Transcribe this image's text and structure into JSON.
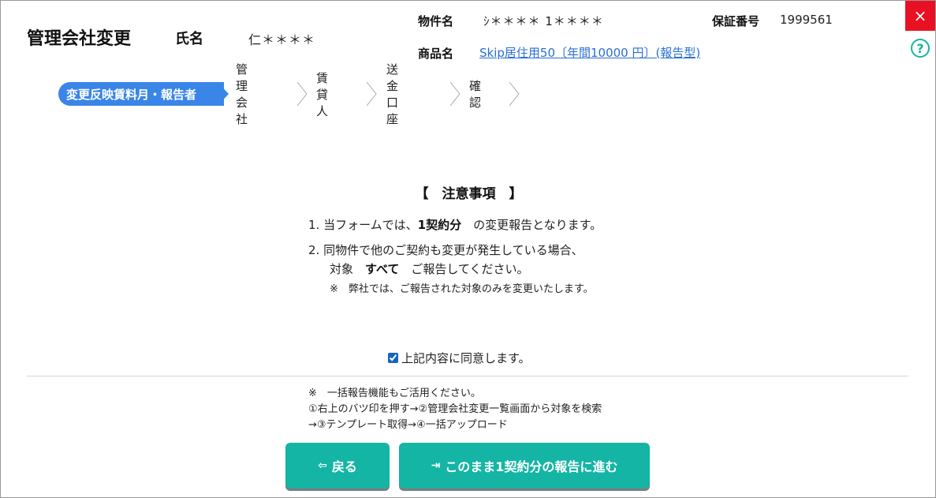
{
  "window": {
    "close_icon": "×",
    "help_icon": "?"
  },
  "header": {
    "title": "管理会社変更",
    "name_label": "氏名",
    "name_value": "仁＊＊＊＊",
    "property_label": "物件名",
    "property_value": "ｼ＊＊＊＊ 1＊＊＊＊",
    "guarantee_label": "保証番号",
    "guarantee_value": "1999561",
    "product_label": "商品名",
    "product_value": "Skip居住用50〔年間10000 円〕(報告型)"
  },
  "steps": [
    {
      "label": "変更反映賃料月・報告者",
      "active": true
    },
    {
      "label": "管理会社",
      "active": false
    },
    {
      "label": "賃貸人",
      "active": false
    },
    {
      "label": "送金口座",
      "active": false
    },
    {
      "label": "確認",
      "active": false
    }
  ],
  "notice": {
    "title": "【　注意事項　】",
    "item1_prefix": "1. 当フォームでは、",
    "item1_bold": "1契約分",
    "item1_suffix": "　の変更報告となります。",
    "item2_line1": "2. 同物件で他のご契約も変更が発生している場合、",
    "item2_line2_prefix": "対象　",
    "item2_line2_bold": "すべて",
    "item2_line2_suffix": "　ご報告してください。",
    "item2_note": "※　弊社では、ご報告された対象のみを変更いたします。"
  },
  "agree": {
    "label": "上記内容に同意します。",
    "checked": true
  },
  "tips": {
    "line1": "※　一括報告機能もご活用ください。",
    "line2": "①右上のバツ印を押す→②管理会社変更一覧画面から対象を検索",
    "line3": "→③テンプレート取得→④一括アップロード"
  },
  "buttons": {
    "back_label": "戻る",
    "back_icon": "⇦",
    "proceed_label": "このまま1契約分の報告に進む",
    "proceed_icon": "⇥"
  },
  "colors": {
    "accent": "#14b5a4",
    "step_active": "#3a85e8",
    "close": "#e81123",
    "link": "#2a6fd6"
  }
}
